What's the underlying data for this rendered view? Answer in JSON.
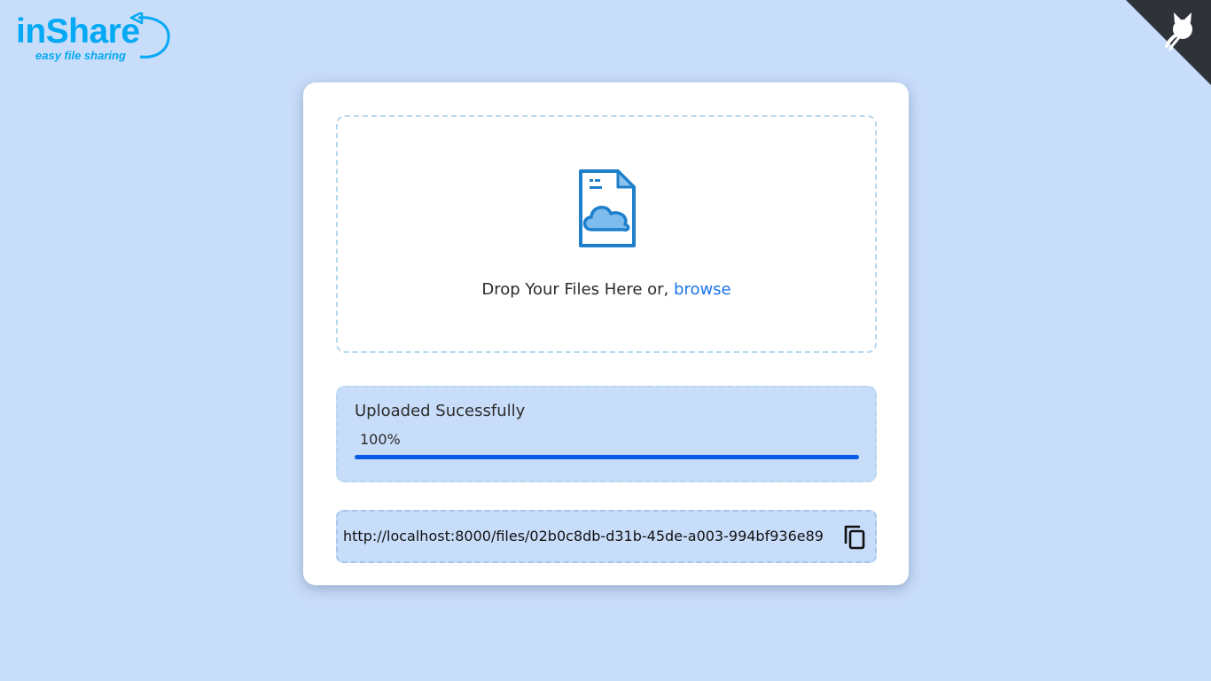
{
  "logo": {
    "main_text": "inShare",
    "tagline": "easy file sharing"
  },
  "corner": {
    "icon": "github-icon"
  },
  "drop_zone": {
    "icon": "file-cloud-icon",
    "text": "Drop Your Files Here or, ",
    "browse_label": "browse"
  },
  "progress": {
    "title": "Uploaded Sucessfully",
    "percent_label": "100%",
    "value": 1.0
  },
  "share_link": {
    "url": "http://localhost:8000/files/02b0c8db-d31b-45de-a003-994bf936e89",
    "copy_icon": "copy-icon"
  },
  "colors": {
    "background": "#c8ddfa",
    "accent": "#03a9f4",
    "link": "#1a73e8",
    "progress": "#0a5ce8"
  }
}
